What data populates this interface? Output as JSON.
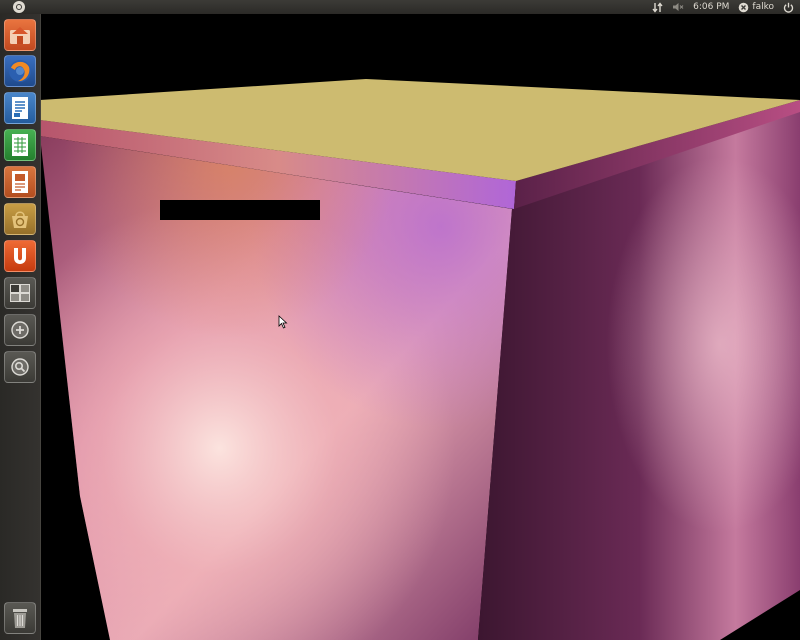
{
  "top_panel": {
    "time": "6:06 PM",
    "user": "falko",
    "icons": [
      "network-icon",
      "sound-muted-icon",
      "mail-icon",
      "shutdown-icon"
    ]
  },
  "launcher": {
    "items": [
      {
        "name": "home-folder-icon",
        "color": "#d8562b"
      },
      {
        "name": "firefox-icon",
        "color": "#2b5fb0"
      },
      {
        "name": "writer-icon",
        "color": "#2a6fb8"
      },
      {
        "name": "calc-icon",
        "color": "#2f9a3a"
      },
      {
        "name": "impress-icon",
        "color": "#c45a2a"
      },
      {
        "name": "software-center-icon",
        "color": "#b58a2e"
      },
      {
        "name": "ubuntu-one-icon",
        "color": "#dd4814"
      },
      {
        "name": "workspace-switcher-icon",
        "color": "#4a4944"
      },
      {
        "name": "applications-lens-icon",
        "color": "#4a4944"
      },
      {
        "name": "files-lens-icon",
        "color": "#4a4944"
      }
    ],
    "trash": {
      "name": "trash-icon"
    }
  },
  "colors": {
    "cube_top": "#cdbb70",
    "panel": "#3c3b37"
  }
}
